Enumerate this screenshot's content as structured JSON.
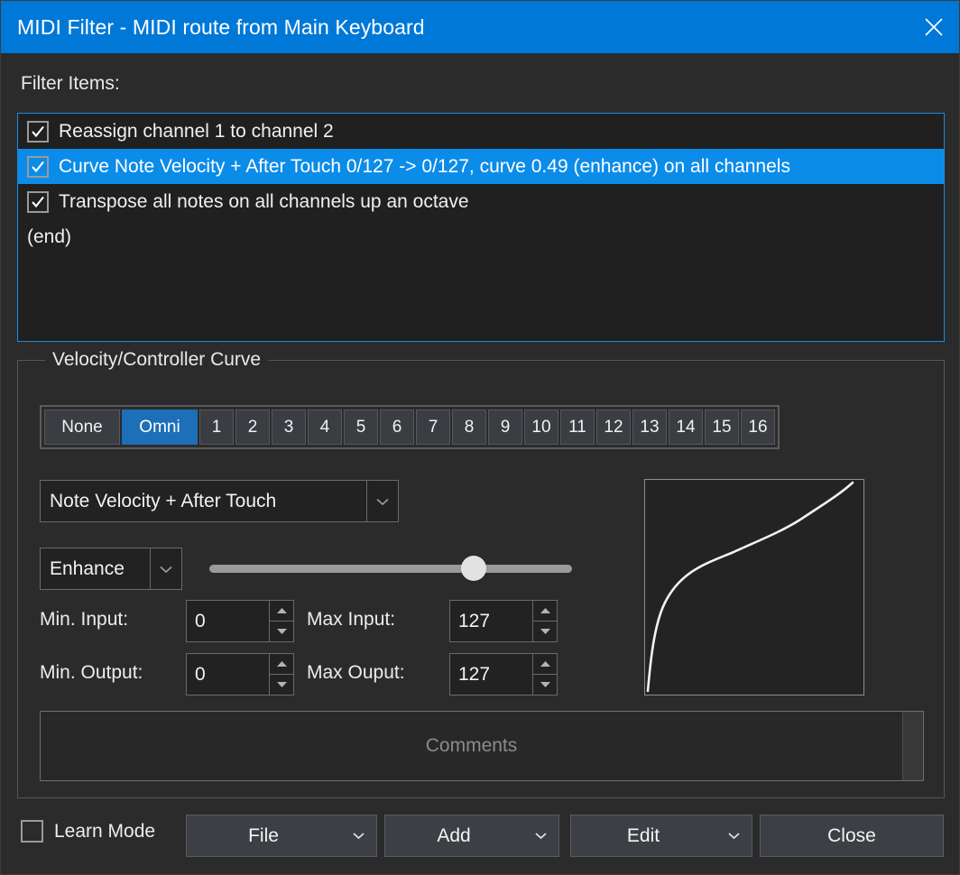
{
  "window": {
    "title": "MIDI Filter - MIDI route from Main Keyboard",
    "close_icon": "close-icon",
    "accent_color": "#0078d7"
  },
  "filter_section": {
    "label": "Filter Items:",
    "items": [
      {
        "checked": true,
        "label": "Reassign channel 1 to channel 2",
        "selected": false
      },
      {
        "checked": true,
        "label": "Curve Note Velocity + After Touch 0/127 -> 0/127, curve 0.49 (enhance) on all channels",
        "selected": true
      },
      {
        "checked": true,
        "label": "Transpose all notes on all channels up an octave",
        "selected": false
      }
    ],
    "end_marker": "(end)",
    "selection_color": "#0c8ce9",
    "focus_border_color": "#1c8ade"
  },
  "curve_group": {
    "legend": "Velocity/Controller Curve",
    "channels": {
      "selected": "Omni",
      "buttons": [
        "None",
        "Omni",
        "1",
        "2",
        "3",
        "4",
        "5",
        "6",
        "7",
        "8",
        "9",
        "10",
        "11",
        "12",
        "13",
        "14",
        "15",
        "16"
      ],
      "active_color": "#1d6fb8"
    },
    "source_combo": {
      "value": "Note Velocity + After Touch",
      "arrow_icon": "chevron-down-icon"
    },
    "mode_combo": {
      "value": "Enhance",
      "arrow_icon": "chevron-down-icon"
    },
    "curve_slider": {
      "value": 0.49,
      "percent": 73
    },
    "fields": {
      "min_input": {
        "label": "Min. Input:",
        "value": "0"
      },
      "max_input": {
        "label": "Max Input:",
        "value": "127"
      },
      "min_output": {
        "label": "Min. Output:",
        "value": "0"
      },
      "max_output": {
        "label": "Max Ouput:",
        "value": "127"
      }
    },
    "comments": {
      "placeholder": "Comments",
      "value": ""
    }
  },
  "footer": {
    "learn_mode": {
      "label": "Learn Mode",
      "checked": false
    },
    "buttons": [
      {
        "label": "File",
        "has_menu": true
      },
      {
        "label": "Add",
        "has_menu": true
      },
      {
        "label": "Edit",
        "has_menu": true
      },
      {
        "label": "Close",
        "has_menu": false
      }
    ]
  }
}
